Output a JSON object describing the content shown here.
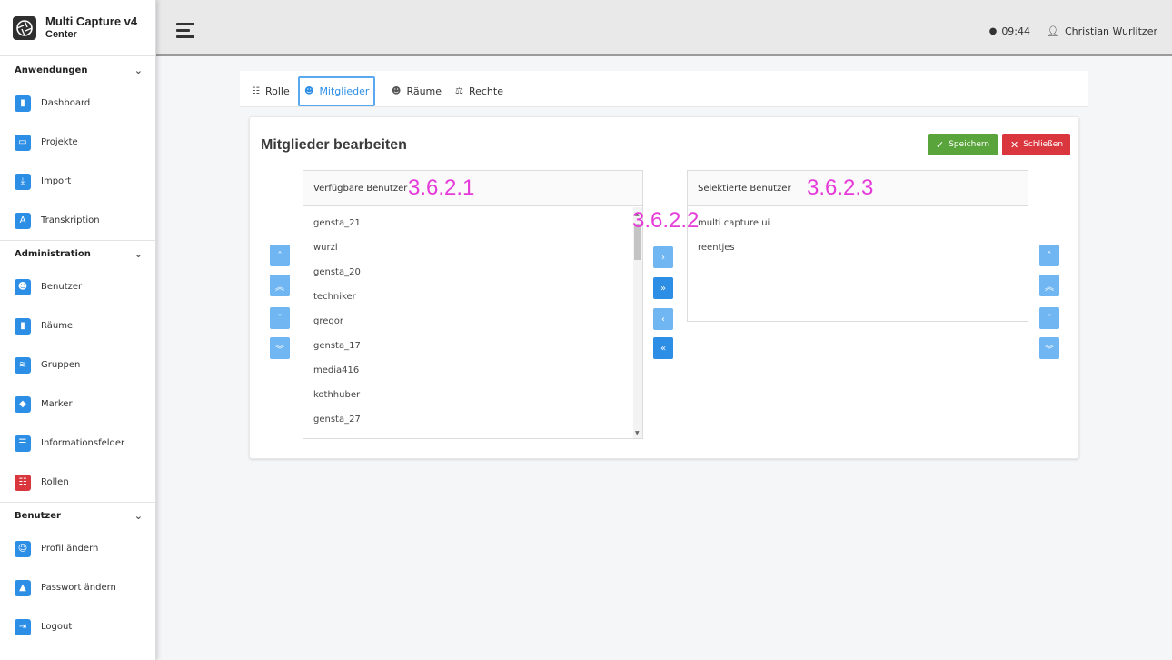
{
  "app": {
    "title": "Multi Capture v4",
    "subtitle": "Center"
  },
  "header": {
    "time": "09:44",
    "user": "Christian Wurlitzer"
  },
  "sidebar": {
    "sections": [
      {
        "label": "Anwendungen",
        "items": [
          {
            "label": "Dashboard",
            "icon": "door-icon",
            "glyph": "▮"
          },
          {
            "label": "Projekte",
            "icon": "monitor-icon",
            "glyph": "▭"
          },
          {
            "label": "Import",
            "icon": "download-icon",
            "glyph": "⤓"
          },
          {
            "label": "Transkription",
            "icon": "font-icon",
            "glyph": "A"
          }
        ]
      },
      {
        "label": "Administration",
        "items": [
          {
            "label": "Benutzer",
            "icon": "users-icon",
            "glyph": "☻"
          },
          {
            "label": "Räume",
            "icon": "door-icon",
            "glyph": "▮"
          },
          {
            "label": "Gruppen",
            "icon": "layers-icon",
            "glyph": "≋"
          },
          {
            "label": "Marker",
            "icon": "tag-icon",
            "glyph": "◆"
          },
          {
            "label": "Informationsfelder",
            "icon": "list-icon",
            "glyph": "☰"
          },
          {
            "label": "Rollen",
            "icon": "roles-icon",
            "glyph": "☷"
          }
        ]
      },
      {
        "label": "Benutzer",
        "items": [
          {
            "label": "Profil ändern",
            "icon": "user-icon",
            "glyph": "☺"
          },
          {
            "label": "Passwort ändern",
            "icon": "lock-icon",
            "glyph": "▲"
          },
          {
            "label": "Logout",
            "icon": "logout-icon",
            "glyph": "⇥"
          }
        ]
      }
    ]
  },
  "tabs": [
    {
      "label": "Rolle",
      "icon": "roles-icon"
    },
    {
      "label": "Mitglieder",
      "icon": "users-icon",
      "active": true
    },
    {
      "label": "Räume",
      "icon": "users-icon"
    },
    {
      "label": "Rechte",
      "icon": "scale-icon"
    }
  ],
  "page": {
    "title": "Mitglieder bearbeiten",
    "save_label": "Speichern",
    "close_label": "Schließen"
  },
  "available": {
    "header": "Verfügbare Benutzer",
    "annotation": "3.6.2.1",
    "users": [
      "gensta_21",
      "wurzl",
      "gensta_20",
      "techniker",
      "gregor",
      "gensta_17",
      "media416",
      "kothhuber",
      "gensta_27"
    ]
  },
  "transfer_annotation": "3.6.2.2",
  "selected": {
    "header": "Selektierte Benutzer",
    "annotation": "3.6.2.3",
    "users": [
      "multi capture ui",
      "reentjes"
    ]
  },
  "colors": {
    "primary": "#2d8ee6",
    "success": "#5aa43c",
    "danger": "#d9363e",
    "annotation": "#e63ad9"
  }
}
